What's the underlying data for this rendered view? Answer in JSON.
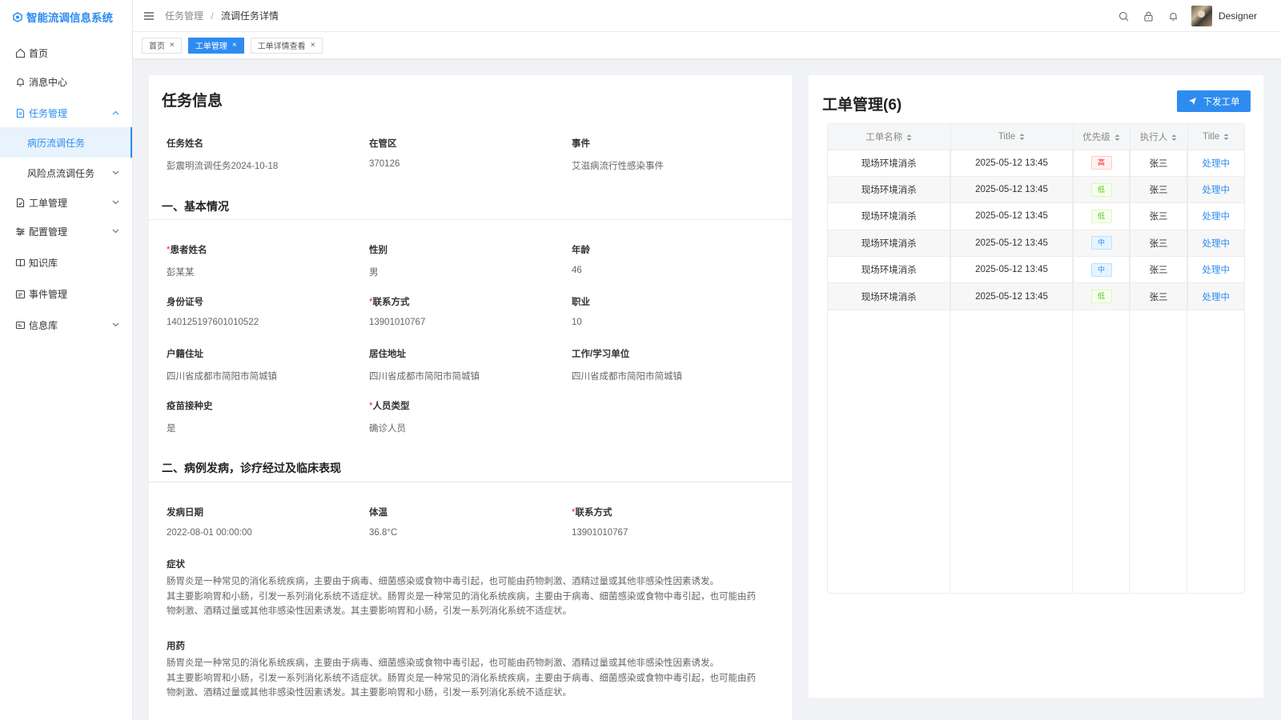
{
  "app": {
    "title": "智能流调信息系统"
  },
  "sidebar": {
    "items": [
      {
        "label": "首页"
      },
      {
        "label": "消息中心"
      },
      {
        "label": "任务管理"
      },
      {
        "label": "病历流调任务"
      },
      {
        "label": "风险点流调任务"
      },
      {
        "label": "工单管理"
      },
      {
        "label": "配置管理"
      },
      {
        "label": "知识库"
      },
      {
        "label": "事件管理"
      },
      {
        "label": "信息库"
      }
    ]
  },
  "header": {
    "breadcrumb": [
      "任务管理",
      "流调任务详情"
    ],
    "separator": "/",
    "username": "Designer"
  },
  "tabs": [
    {
      "label": "首页"
    },
    {
      "label": "工单管理"
    },
    {
      "label": "工单详情查看"
    }
  ],
  "task": {
    "title": "任务信息",
    "fields": [
      {
        "label": "任务姓名",
        "value": "彭震明流调任务2024-10-18"
      },
      {
        "label": "在管区",
        "value": "370126"
      },
      {
        "label": "事件",
        "value": "艾滋病流行性感染事件"
      }
    ]
  },
  "basic": {
    "title": "一、基本情况",
    "fields": [
      {
        "label": "患者姓名",
        "value": "彭某某",
        "required": true
      },
      {
        "label": "性别",
        "value": "男"
      },
      {
        "label": "年龄",
        "value": "46"
      },
      {
        "label": "身份证号",
        "value": "140125197601010522"
      },
      {
        "label": "联系方式",
        "value": "13901010767",
        "required": true
      },
      {
        "label": "职业",
        "value": "10"
      },
      {
        "label": "户籍住址",
        "value": "四川省成都市简阳市简城镇"
      },
      {
        "label": "居住地址",
        "value": "四川省成都市简阳市简城镇"
      },
      {
        "label": "工作/学习单位",
        "value": "四川省成都市简阳市简城镇"
      },
      {
        "label": "疫苗接种史",
        "value": "是"
      },
      {
        "label": "人员类型",
        "value": "确诊人员",
        "required": true
      }
    ]
  },
  "clinical": {
    "title": "二、病例发病，诊疗经过及临床表现",
    "fields": [
      {
        "label": "发病日期",
        "value": "2022-08-01 00:00:00"
      },
      {
        "label": "体温",
        "value": "36.8°C"
      },
      {
        "label": "联系方式",
        "value": "13901010767",
        "required": true
      }
    ],
    "symptoms_label": "症状",
    "symptoms": [
      "肠胃炎是一种常见的消化系统疾病，主要由于病毒、细菌感染或食物中毒引起，也可能由药物刺激、酒精过量或其他非感染性因素诱发。",
      "其主要影响胃和小肠，引发一系列消化系统不适症状。肠胃炎是一种常见的消化系统疾病，主要由于病毒、细菌感染或食物中毒引起，也可能由药",
      "物刺激、酒精过量或其他非感染性因素诱发。其主要影响胃和小肠，引发一系列消化系统不适症状。"
    ],
    "medication_label": "用药",
    "medication": [
      "肠胃炎是一种常见的消化系统疾病，主要由于病毒、细菌感染或食物中毒引起，也可能由药物刺激、酒精过量或其他非感染性因素诱发。",
      "其主要影响胃和小肠，引发一系列消化系统不适症状。肠胃炎是一种常见的消化系统疾病，主要由于病毒、细菌感染或食物中毒引起，也可能由药",
      "物刺激、酒精过量或其他非感染性因素诱发。其主要影响胃和小肠，引发一系列消化系统不适症状。"
    ]
  },
  "workorders": {
    "title": "工单管理(6)",
    "issue_button": "下发工单",
    "columns": [
      "工单名称",
      "Title",
      "优先级",
      "执行人",
      "Title"
    ],
    "rows": [
      {
        "name": "现场环境消杀",
        "time": "2025-05-12 13:45",
        "priority": "高",
        "level": "high",
        "assignee": "张三",
        "status": "处理中"
      },
      {
        "name": "现场环境消杀",
        "time": "2025-05-12 13:45",
        "priority": "低",
        "level": "low",
        "assignee": "张三",
        "status": "处理中"
      },
      {
        "name": "现场环境消杀",
        "time": "2025-05-12 13:45",
        "priority": "低",
        "level": "low",
        "assignee": "张三",
        "status": "处理中"
      },
      {
        "name": "现场环境消杀",
        "time": "2025-05-12 13:45",
        "priority": "中",
        "level": "mid",
        "assignee": "张三",
        "status": "处理中"
      },
      {
        "name": "现场环境消杀",
        "time": "2025-05-12 13:45",
        "priority": "中",
        "level": "mid",
        "assignee": "张三",
        "status": "处理中"
      },
      {
        "name": "现场环境消杀",
        "time": "2025-05-12 13:45",
        "priority": "低",
        "level": "low",
        "assignee": "张三",
        "status": "处理中"
      }
    ]
  },
  "colors": {
    "accent": "#2e8cf0",
    "required": "#f5222d",
    "high": "#f5222d",
    "low": "#52c41a",
    "mid": "#2e8cf0"
  }
}
